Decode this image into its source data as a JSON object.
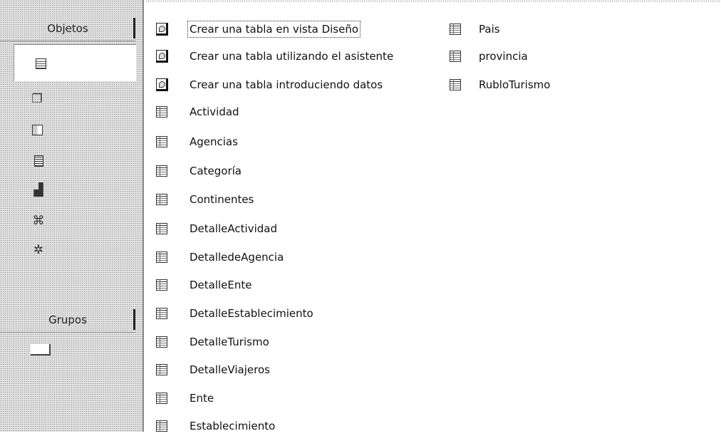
{
  "sidebar": {
    "objects_header": "Objetos",
    "groups_header": "Grupos",
    "object_icons": [
      "table-icon",
      "query-icon",
      "form-icon",
      "report-icon",
      "page-icon",
      "macro-icon",
      "module-icon"
    ]
  },
  "list": {
    "column1": [
      {
        "label": "Crear una tabla en vista Diseño",
        "icon": "wizard-icon"
      },
      {
        "label": "Crear una tabla utilizando el asistente",
        "icon": "wizard-icon"
      },
      {
        "label": "Crear una tabla introduciendo datos",
        "icon": "wizard-icon"
      },
      {
        "label": "Actividad",
        "icon": "table-icon"
      },
      {
        "label": "Agencias",
        "icon": "table-icon"
      },
      {
        "label": "Categoría",
        "icon": "table-icon"
      },
      {
        "label": "Continentes",
        "icon": "table-icon"
      },
      {
        "label": "DetalleActividad",
        "icon": "table-icon"
      },
      {
        "label": "DetalledeAgencia",
        "icon": "table-icon"
      },
      {
        "label": "DetalleEnte",
        "icon": "table-icon"
      },
      {
        "label": "DetalleEstablecimiento",
        "icon": "table-icon"
      },
      {
        "label": "DetalleTurismo",
        "icon": "table-icon"
      },
      {
        "label": "DetalleViajeros",
        "icon": "table-icon"
      },
      {
        "label": "Ente",
        "icon": "table-icon"
      },
      {
        "label": "Establecimiento",
        "icon": "table-icon"
      }
    ],
    "column2": [
      {
        "label": "Pais",
        "icon": "table-icon"
      },
      {
        "label": "provincia",
        "icon": "table-icon"
      },
      {
        "label": "RubloTurismo",
        "icon": "table-icon"
      }
    ]
  }
}
